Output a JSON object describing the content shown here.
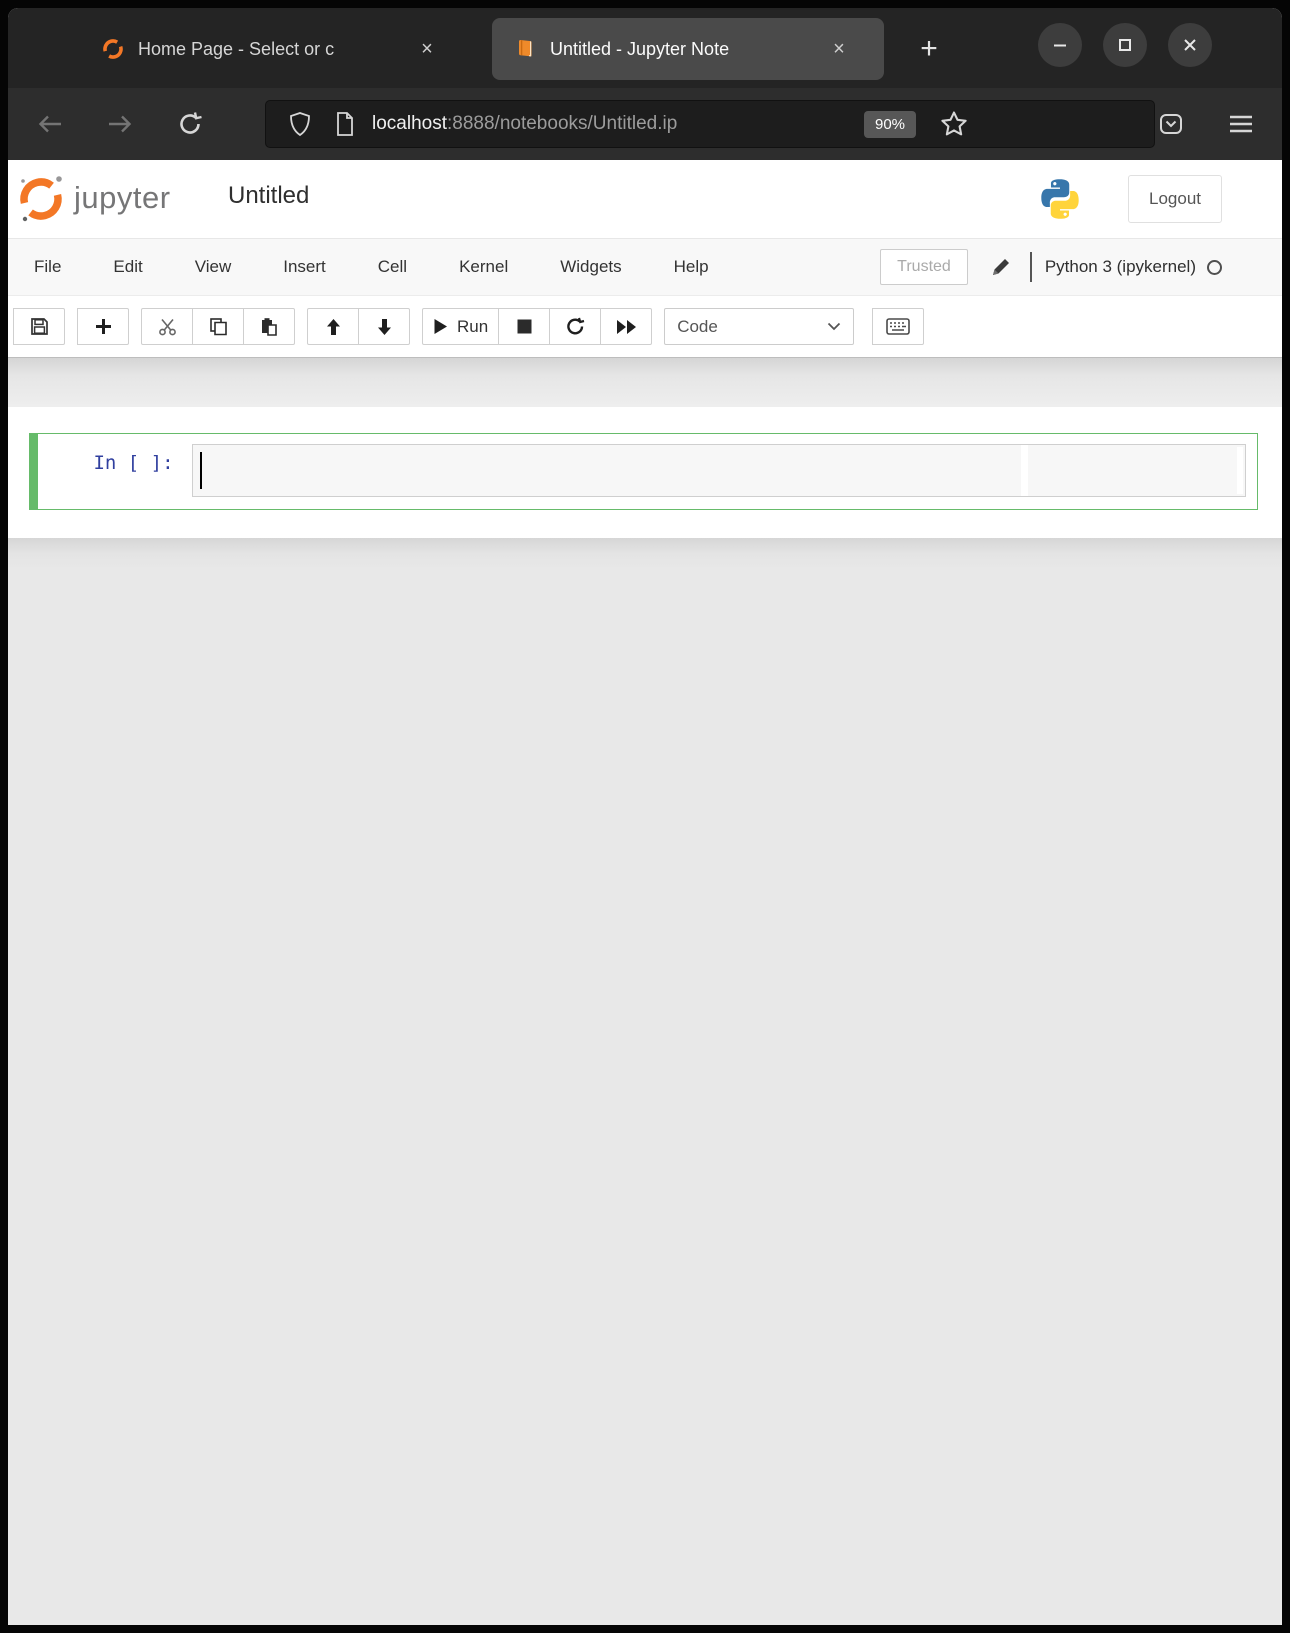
{
  "titlebar": {
    "tabs": [
      {
        "title": "Home Page - Select or c"
      },
      {
        "title": "Untitled - Jupyter Note"
      }
    ],
    "close_glyph": "×",
    "new_tab_glyph": "+"
  },
  "navbar": {
    "url_host": "localhost",
    "url_path": ":8888/notebooks/Untitled.ip",
    "zoom_badge": "90%"
  },
  "header": {
    "logo_text": "jupyter",
    "notebook_title": "Untitled",
    "logout_label": "Logout"
  },
  "menubar": {
    "items": [
      "File",
      "Edit",
      "View",
      "Insert",
      "Cell",
      "Kernel",
      "Widgets",
      "Help"
    ],
    "trusted_label": "Trusted",
    "kernel_name": "Python 3 (ipykernel)"
  },
  "toolbar": {
    "run_label": "Run",
    "cell_type": "Code"
  },
  "notebook": {
    "cell_prompt": "In [ ]: ",
    "cell_input": ""
  },
  "colors": {
    "jupyter_orange": "#f37726",
    "cell_selected_green": "#66bb6a",
    "prompt_blue": "#303f9f",
    "python_blue": "#3776ab",
    "python_yellow": "#ffd43b"
  }
}
